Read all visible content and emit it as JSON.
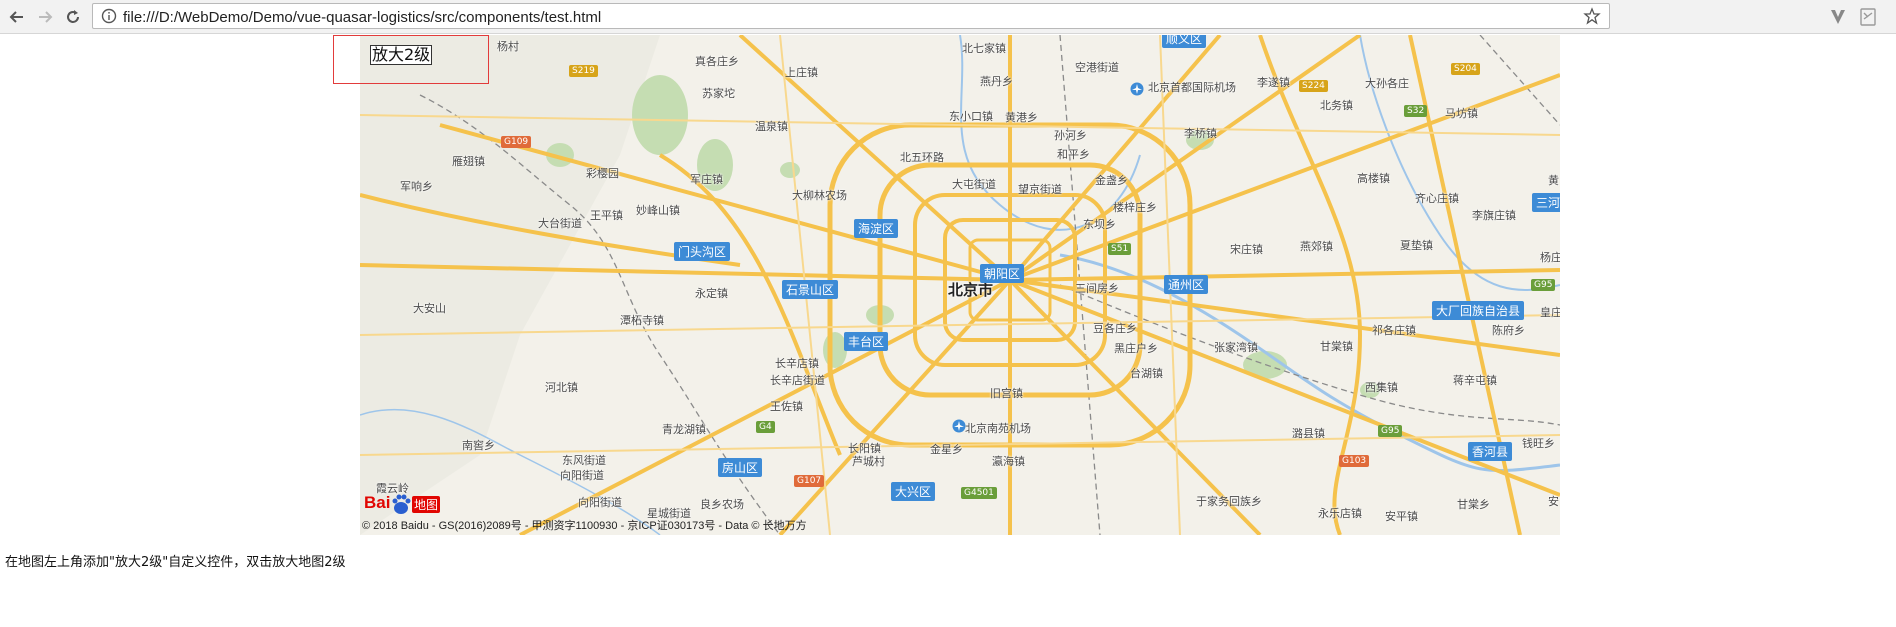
{
  "browser": {
    "url": "file:///D:/WebDemo/Demo/vue-quasar-logistics/src/components/test.html"
  },
  "control": {
    "label": "放大2级"
  },
  "map": {
    "city_label": "北京市",
    "districts": [
      "海淀区",
      "门头沟区",
      "石景山区",
      "朝阳区",
      "丰台区",
      "通州区",
      "大厂回族自治县",
      "房山区",
      "大兴区",
      "香河县",
      "顺义区",
      "三河"
    ],
    "places": [
      "杨村",
      "真各庄乡",
      "上庄镇",
      "北七家镇",
      "空港街道",
      "李遂镇",
      "大孙各庄",
      "苏家坨",
      "燕丹乡",
      "北京首都国际机场",
      "北务镇",
      "马坊镇",
      "温泉镇",
      "东小口镇",
      "黄港乡",
      "孙河乡",
      "李桥镇",
      "雁翅镇",
      "北五环路",
      "和平乡",
      "高楼镇",
      "彩樱园",
      "军庄镇",
      "大柳林农场",
      "大屯街道",
      "望京街道",
      "金盏乡",
      "黄",
      "军响乡",
      "王平镇",
      "妙峰山镇",
      "楼梓庄乡",
      "齐心庄镇",
      "李旗庄镇",
      "大台街道",
      "东坝乡",
      "宋庄镇",
      "燕郊镇",
      "夏垫镇",
      "杨庄",
      "永定镇",
      "三间房乡",
      "皇庄",
      "大安山",
      "潭柘寺镇",
      "豆各庄乡",
      "祁各庄镇",
      "陈府乡",
      "黑庄户乡",
      "张家湾镇",
      "甘棠镇",
      "长辛店镇",
      "长辛店街道",
      "台湖镇",
      "河北镇",
      "西集镇",
      "蒋辛屯镇",
      "旧宫镇",
      "王佐镇",
      "北京南苑机场",
      "青龙湖镇",
      "长阳镇",
      "潞县镇",
      "钱旺乡",
      "南窖乡",
      "东风街道",
      "金星乡",
      "瀛海镇",
      "芦城村",
      "向阳街道",
      "霞云岭",
      "永乐店镇",
      "向阳街道",
      "星城街道",
      "于家务回族乡",
      "安平镇",
      "良乡农场",
      "甘棠乡",
      "安"
    ],
    "roads": [
      "S219",
      "G109",
      "S224",
      "S204",
      "S32",
      "S51",
      "G95",
      "G4",
      "G107",
      "G4501",
      "G95",
      "G103"
    ],
    "copyright": "© 2018 Baidu - GS(2016)2089号 - 甲测资字1100930 - 京ICP证030173号 - Data © 长地万方",
    "logo_text": "Bai",
    "logo_ditu": "地图"
  },
  "description": "在地图左上角添加\"放大2级\"自定义控件，双击放大地图2级",
  "colors": {
    "road": "#f5c24c",
    "district_badge": "#3d8bd6",
    "control_border": "#e23b3b"
  },
  "icons": [
    "back-arrow-icon",
    "forward-arrow-icon",
    "reload-icon",
    "info-icon",
    "bookmark-star-icon",
    "extension-v-icon",
    "extension-pdf-icon",
    "airport-icon"
  ]
}
